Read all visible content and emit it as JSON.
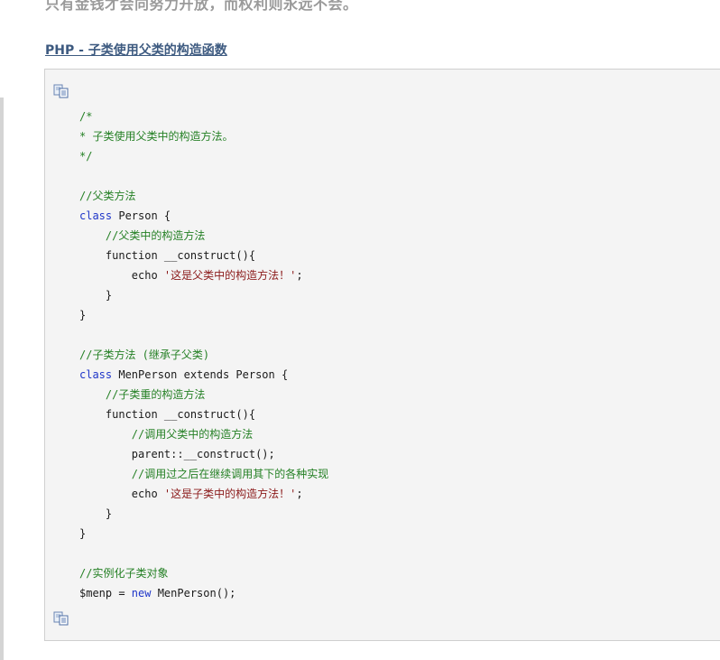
{
  "article": {
    "top_text": "只有金钱才会向努力开放，而权利则永远不会。",
    "heading": "PHP - 子类使用父类的构造函数"
  },
  "icons": {
    "copy": "copy-icon"
  },
  "colors": {
    "comment": "#258025",
    "keyword": "#1f36c9",
    "string": "#8b1a1a",
    "plain": "#1a1a1a",
    "heading": "#3d5a80",
    "code_bg": "#f4f4f4"
  },
  "code": {
    "lines": [
      [
        {
          "t": "cm",
          "v": "/*"
        }
      ],
      [
        {
          "t": "cm",
          "v": "* 子类使用父类中的构造方法。"
        }
      ],
      [
        {
          "t": "cm",
          "v": "*/"
        }
      ],
      [],
      [
        {
          "t": "cm",
          "v": "//父类方法"
        }
      ],
      [
        {
          "t": "kw",
          "v": "class"
        },
        {
          "t": "pl",
          "v": " Person {"
        }
      ],
      [
        {
          "t": "pl",
          "v": "    "
        },
        {
          "t": "cm",
          "v": "//父类中的构造方法"
        }
      ],
      [
        {
          "t": "pl",
          "v": "    function __construct(){"
        }
      ],
      [
        {
          "t": "pl",
          "v": "        echo "
        },
        {
          "t": "st",
          "v": "'这是父类中的构造方法！'"
        },
        {
          "t": "pl",
          "v": ";"
        }
      ],
      [
        {
          "t": "pl",
          "v": "    }"
        }
      ],
      [
        {
          "t": "pl",
          "v": "}"
        }
      ],
      [],
      [
        {
          "t": "cm",
          "v": "//子类方法 (继承子父类)"
        }
      ],
      [
        {
          "t": "kw",
          "v": "class"
        },
        {
          "t": "pl",
          "v": " MenPerson extends Person {"
        }
      ],
      [
        {
          "t": "pl",
          "v": "    "
        },
        {
          "t": "cm",
          "v": "//子类重的构造方法"
        }
      ],
      [
        {
          "t": "pl",
          "v": "    function __construct(){"
        }
      ],
      [
        {
          "t": "pl",
          "v": "        "
        },
        {
          "t": "cm",
          "v": "//调用父类中的构造方法"
        }
      ],
      [
        {
          "t": "pl",
          "v": "        parent::__construct();"
        }
      ],
      [
        {
          "t": "pl",
          "v": "        "
        },
        {
          "t": "cm",
          "v": "//调用过之后在继续调用其下的各种实现"
        }
      ],
      [
        {
          "t": "pl",
          "v": "        echo "
        },
        {
          "t": "st",
          "v": "'这是子类中的构造方法！'"
        },
        {
          "t": "pl",
          "v": ";"
        }
      ],
      [
        {
          "t": "pl",
          "v": "    }"
        }
      ],
      [
        {
          "t": "pl",
          "v": "}"
        }
      ],
      [],
      [
        {
          "t": "cm",
          "v": "//实例化子类对象"
        }
      ],
      [
        {
          "t": "pl",
          "v": "$menp = "
        },
        {
          "t": "kw",
          "v": "new"
        },
        {
          "t": "pl",
          "v": " MenPerson();"
        }
      ]
    ]
  }
}
